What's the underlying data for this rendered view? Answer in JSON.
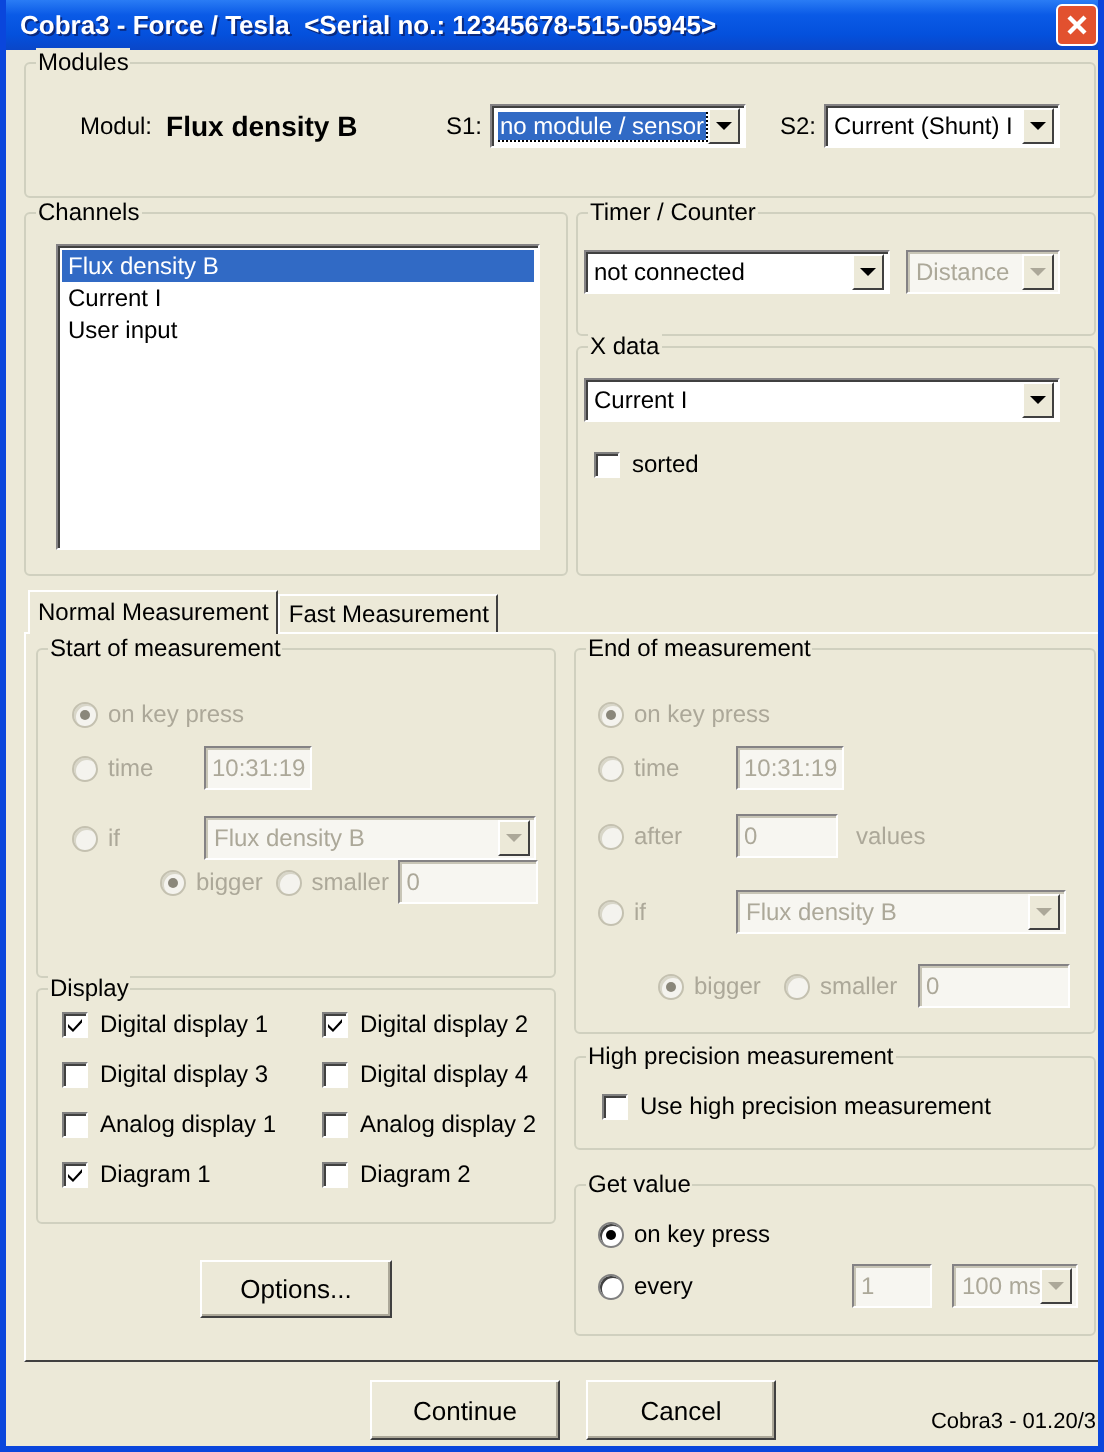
{
  "window": {
    "title": "Cobra3 - Force / Tesla  <Serial no.: 12345678-515-05945>"
  },
  "modules": {
    "title": "Modules",
    "modul_label": "Modul:",
    "modul_value": "Flux density B",
    "s1": {
      "label": "S1:",
      "value": "no module / sensor",
      "focused": true
    },
    "s2": {
      "label": "S2:",
      "value": "Current (Shunt) I",
      "focused": false
    }
  },
  "channels": {
    "title": "Channels",
    "items": [
      {
        "label": "Flux density B",
        "selected": true
      },
      {
        "label": "Current I",
        "selected": false
      },
      {
        "label": "User input",
        "selected": false
      }
    ]
  },
  "timer_counter": {
    "title": "Timer / Counter",
    "source": {
      "value": "not connected",
      "disabled": false
    },
    "mode": {
      "value": "Distance",
      "disabled": true
    }
  },
  "x_data": {
    "title": "X data",
    "value": "Current I",
    "sorted": {
      "label": "sorted",
      "checked": false
    }
  },
  "tabs": [
    {
      "label": "Normal Measurement",
      "selected": true
    },
    {
      "label": "Fast Measurement",
      "selected": false
    }
  ],
  "start": {
    "title": "Start of measurement",
    "disabled": true,
    "options": [
      {
        "kind": "plain",
        "label": "on key press",
        "selected": true
      },
      {
        "kind": "time",
        "label": "time",
        "selected": false,
        "value": "10:31:19"
      },
      {
        "kind": "condition",
        "label": "if",
        "selected": false,
        "value": "Flux density B"
      }
    ],
    "compare": [
      {
        "label": "bigger",
        "selected": true
      },
      {
        "label": "smaller",
        "selected": false
      }
    ],
    "threshold": "0"
  },
  "display": {
    "title": "Display",
    "items": [
      {
        "label": "Digital display 1",
        "checked": true
      },
      {
        "label": "Digital display 2",
        "checked": true
      },
      {
        "label": "Digital display 3",
        "checked": false
      },
      {
        "label": "Digital display 4",
        "checked": false
      },
      {
        "label": "Analog display 1",
        "checked": false
      },
      {
        "label": "Analog display 2",
        "checked": false
      },
      {
        "label": "Diagram 1",
        "checked": true
      },
      {
        "label": "Diagram 2",
        "checked": false
      }
    ]
  },
  "options_button": "Options...",
  "end": {
    "title": "End of measurement",
    "disabled": true,
    "options": [
      {
        "kind": "plain",
        "label": "on key press",
        "selected": true
      },
      {
        "kind": "time",
        "label": "time",
        "selected": false,
        "value": "10:31:19"
      },
      {
        "kind": "count",
        "label": "after",
        "selected": false,
        "value": "0",
        "unit": "values"
      },
      {
        "kind": "condition",
        "label": "if",
        "selected": false,
        "value": "Flux density B"
      }
    ],
    "compare": [
      {
        "label": "bigger",
        "selected": true
      },
      {
        "label": "smaller",
        "selected": false
      }
    ],
    "threshold": "0"
  },
  "high_precision": {
    "title": "High precision measurement",
    "label": "Use high precision measurement",
    "checked": false
  },
  "get_value": {
    "title": "Get value",
    "options": [
      {
        "kind": "plain",
        "label": "on key press",
        "selected": true
      },
      {
        "kind": "interval",
        "label": "every",
        "selected": false,
        "value": "1",
        "unit": "100 ms",
        "disabled": true
      }
    ]
  },
  "buttons": [
    {
      "label": "Continue"
    },
    {
      "label": "Cancel"
    }
  ],
  "version": "Cobra3 - 01.20/3"
}
